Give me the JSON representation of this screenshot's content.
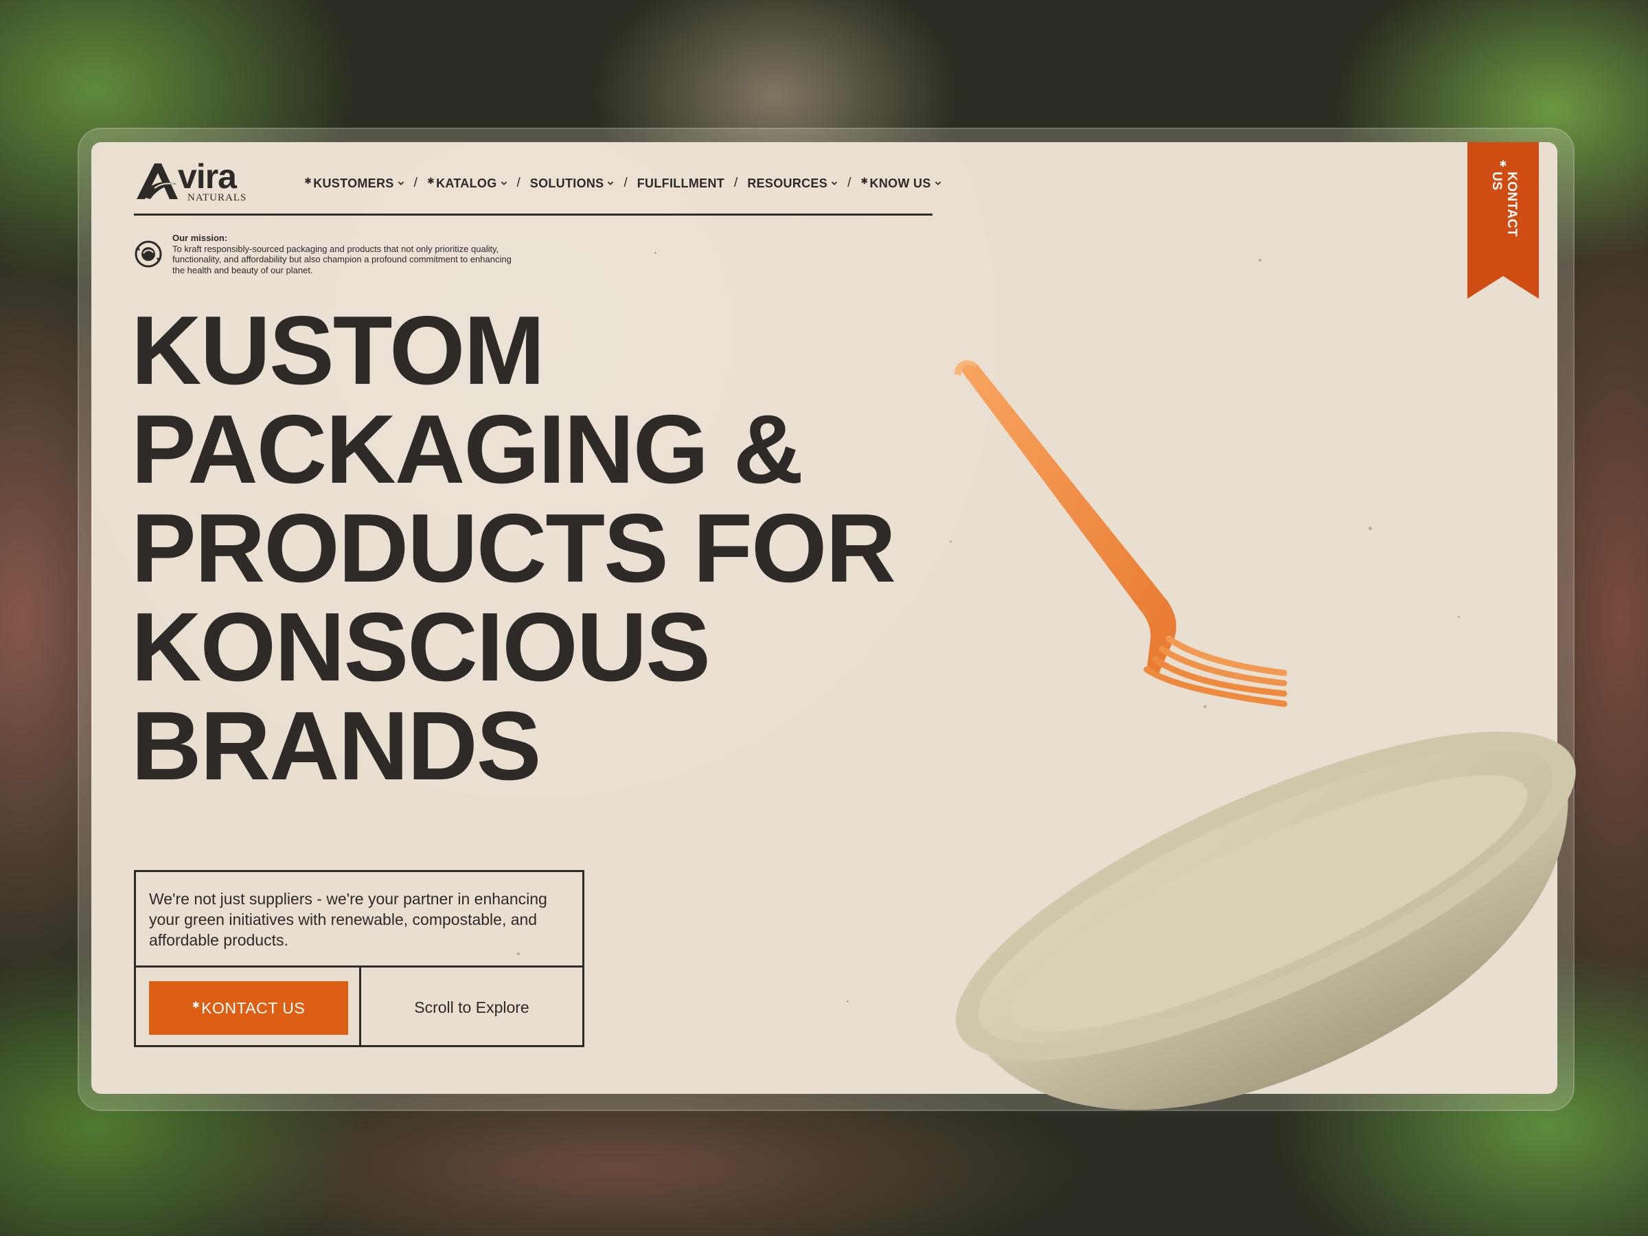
{
  "brand": {
    "name": "vira",
    "initial": "A",
    "tagline": "NATURALS"
  },
  "nav": {
    "items": [
      {
        "prefix": "✱",
        "label": "KUSTOMERS",
        "has_dropdown": true
      },
      {
        "prefix": "✱",
        "label": "KATALOG",
        "has_dropdown": true
      },
      {
        "prefix": "",
        "label": "SOLUTIONS",
        "has_dropdown": true
      },
      {
        "prefix": "",
        "label": "FULFILLMENT",
        "has_dropdown": false
      },
      {
        "prefix": "",
        "label": "RESOURCES",
        "has_dropdown": true
      },
      {
        "prefix": "✱",
        "label": "KNOW US",
        "has_dropdown": true
      }
    ],
    "separator": "/"
  },
  "mission": {
    "title": "Our mission:",
    "text": "To kraft responsibly-sourced packaging and products that not only prioritize quality, functionality, and affordability but also champion a profound commitment to enhancing the health and beauty of our planet."
  },
  "hero": {
    "headline_lines": [
      "KUSTOM",
      "PACKAGING &",
      "PRODUCTS FOR",
      "KONSCIOUS",
      "BRANDS"
    ],
    "lead": "We're not just suppliers - we're your partner in enhancing your green initiatives with renewable, compostable, and affordable products.",
    "cta_prefix": "✱",
    "cta_label": "KONTACT US",
    "scroll_label": "Scroll to Explore"
  },
  "ribbon": {
    "prefix": "✱",
    "label": "KONTACT US"
  },
  "colors": {
    "accent": "#dc5f14",
    "ink": "#2d2a27",
    "paper": "#e9dfd1",
    "fork": "#f08c45",
    "bowl": "#c8c0a3"
  },
  "icons": {
    "mission": "recycle-globe-icon",
    "chevron": "chevron-down-icon"
  }
}
